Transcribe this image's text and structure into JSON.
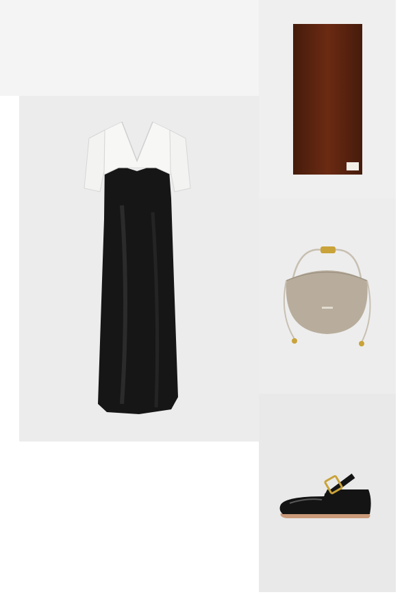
{
  "products": [
    {
      "id": "dress",
      "name": "dress",
      "colors": [
        "#ffffff",
        "#161616"
      ]
    },
    {
      "id": "scarf",
      "name": "scarf",
      "colors": [
        "#6b2a12"
      ]
    },
    {
      "id": "bag",
      "name": "handbag",
      "colors": [
        "#b8ad9c",
        "#c9a33a"
      ]
    },
    {
      "id": "shoe",
      "name": "ballet-flat",
      "colors": [
        "#141414",
        "#c9a33a"
      ]
    }
  ],
  "colors": {
    "page_bg": "#ffffff",
    "tile_bg": "#ececec",
    "dress_black": "#161616",
    "dress_white": "#f7f7f5",
    "scarf_brown": "#6b2a12",
    "bag_taupe": "#b8ad9c",
    "hardware_gold": "#c9a33a",
    "shoe_black": "#141414"
  }
}
